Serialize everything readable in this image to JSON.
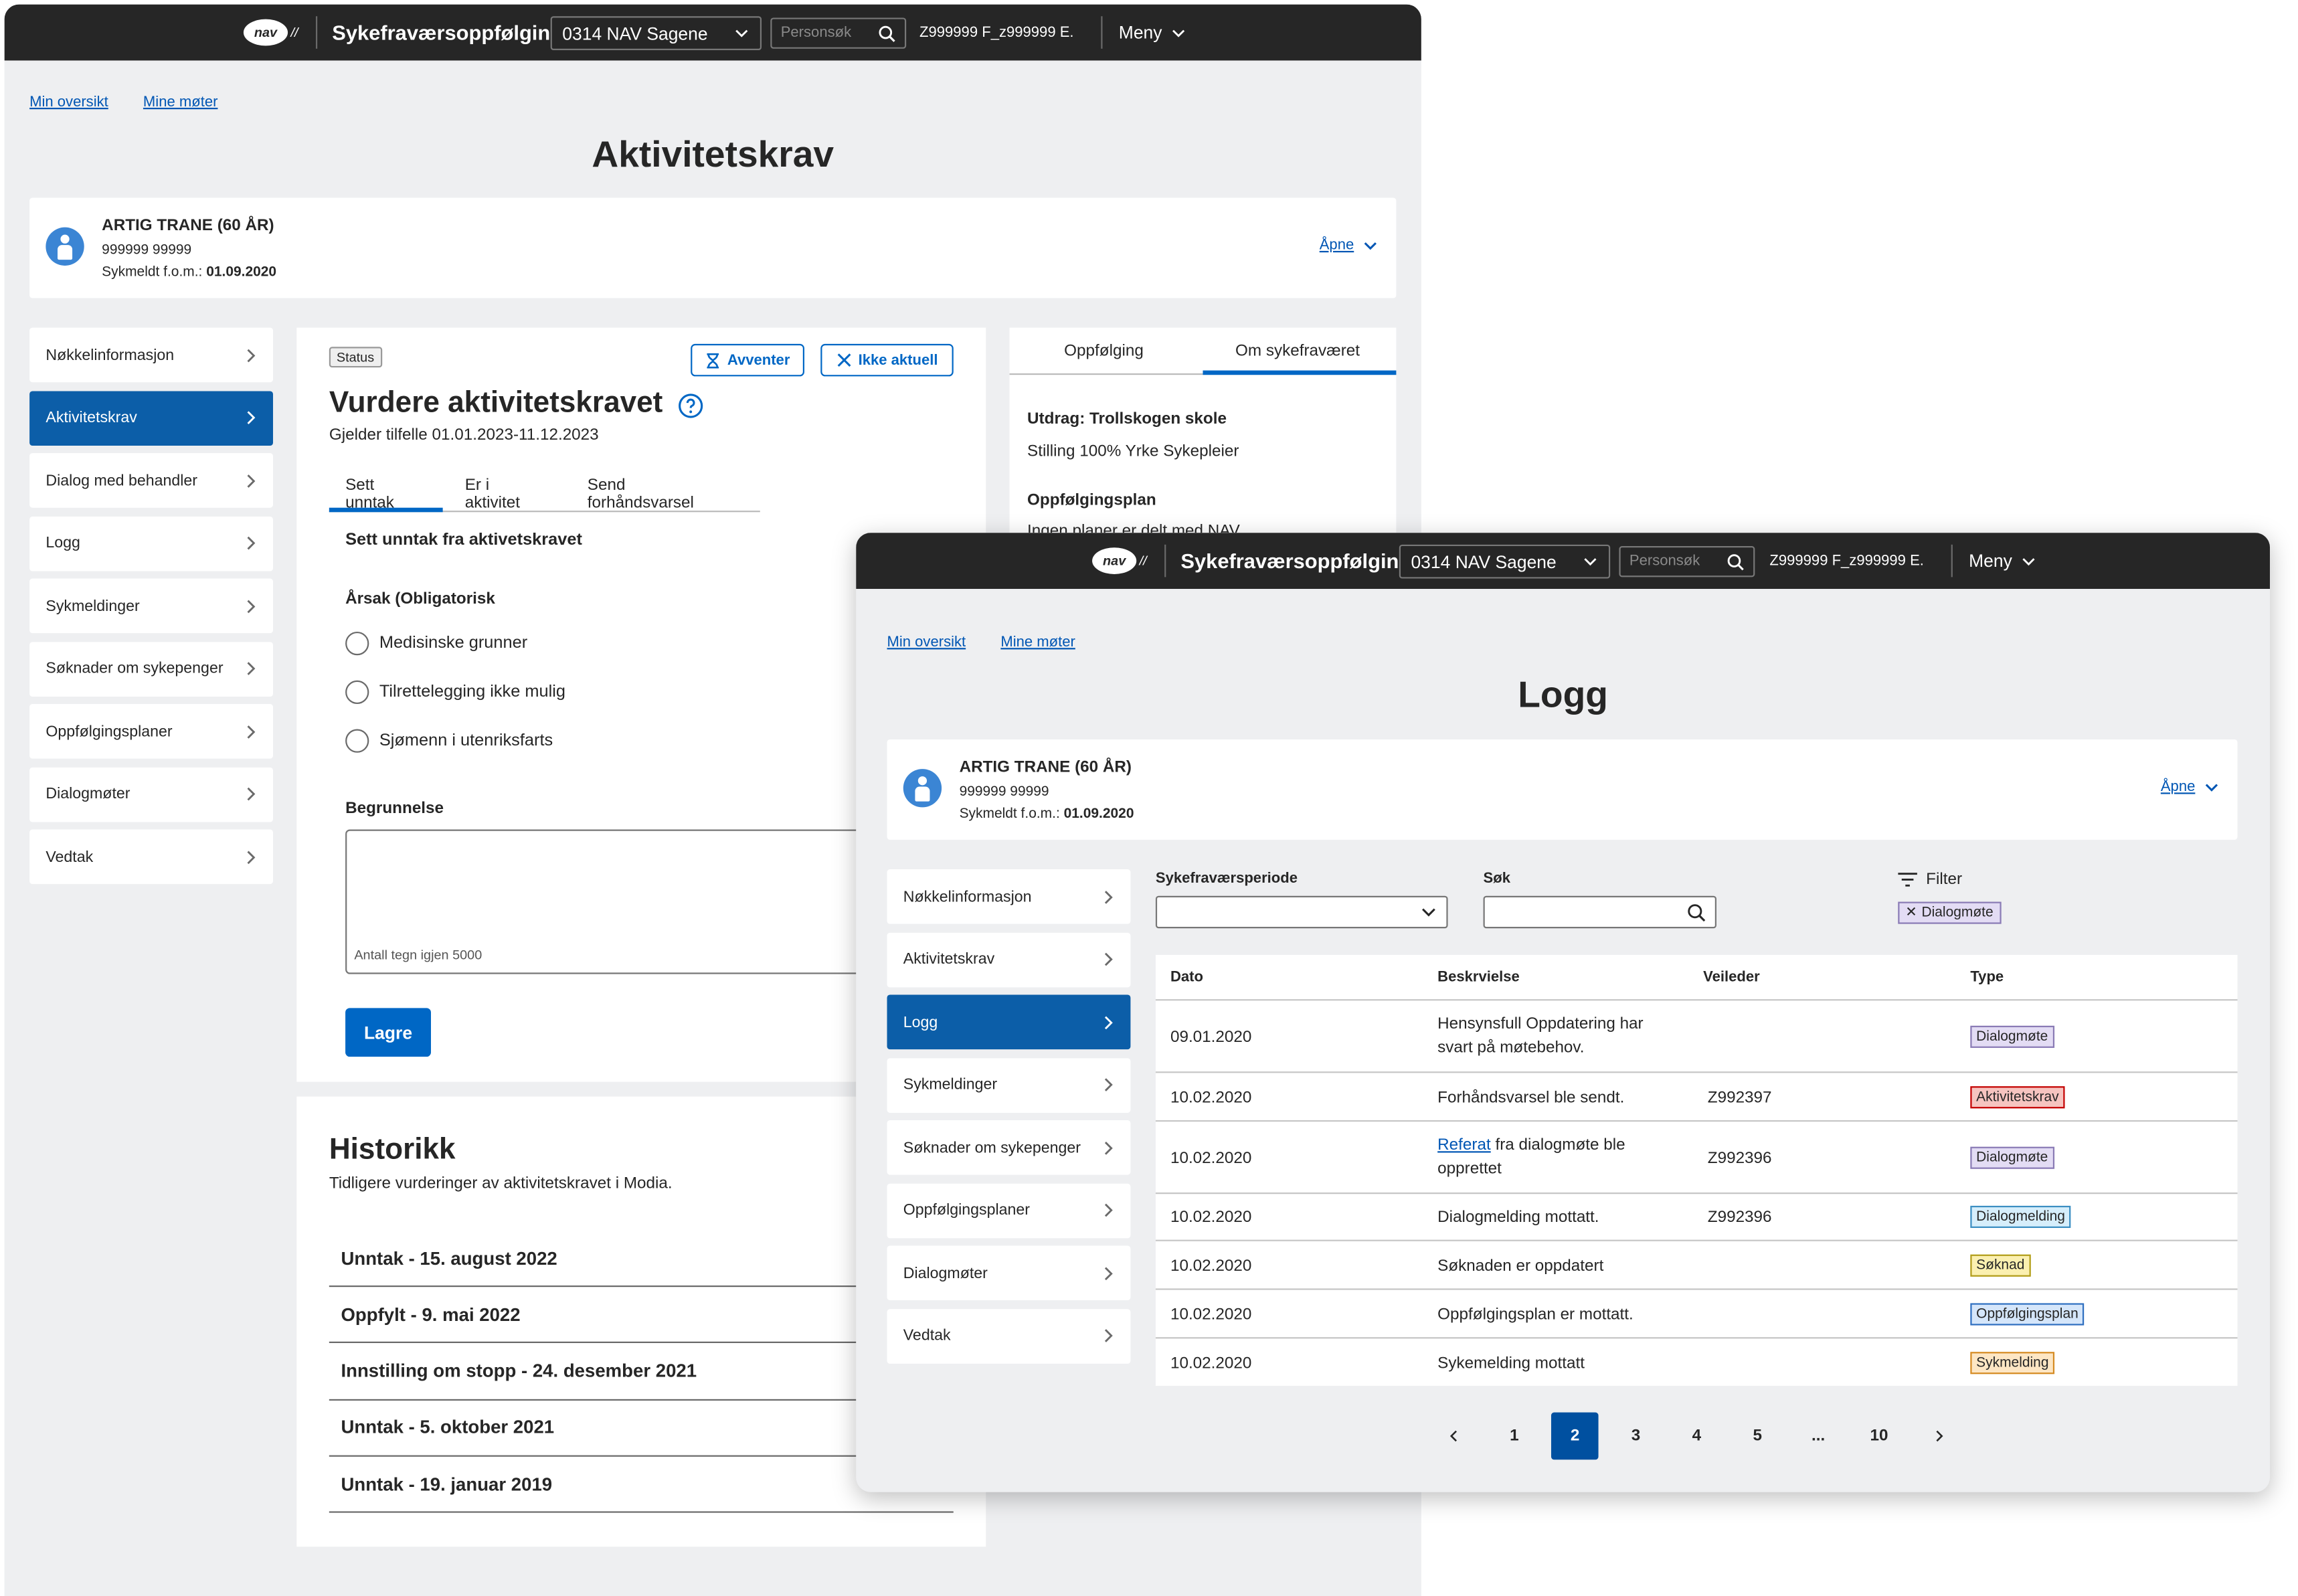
{
  "header": {
    "logo": "nav",
    "app_title": "Sykefraværsoppfølging",
    "unit_select": "0314 NAV Sagene",
    "search_placeholder": "Personsøk",
    "user": "Z999999 F_z999999 E.",
    "menu": "Meny"
  },
  "breadcrumbs": [
    "Min oversikt",
    "Mine møter"
  ],
  "person": {
    "name": "ARTIG TRANE (60 ÅR)",
    "fnr": "999999 99999",
    "sykmeldt_label": "Sykmeldt f.o.m.:",
    "sykmeldt_date": "01.09.2020",
    "open_link": "Åpne"
  },
  "screen_a": {
    "page_title": "Aktivitetskrav",
    "nav": [
      "Nøkkelinformasjon",
      "Aktivitetskrav",
      "Dialog med behandler",
      "Logg",
      "Sykmeldinger",
      "Søknader om sykepenger",
      "Oppfølgingsplaner",
      "Dialogmøter",
      "Vedtak"
    ],
    "status_tag": "Status",
    "avventer_btn": "Avventer",
    "ikke_aktuell_btn": "Ikke aktuell",
    "heading": "Vurdere aktivitetskravet",
    "subheading": "Gjelder tilfelle 01.01.2023-11.12.2023",
    "tabs": [
      "Sett unntak",
      "Er i aktivitet",
      "Send forhåndsvarsel"
    ],
    "form_title": "Sett unntak fra aktivetskravet",
    "reason_label": "Årsak (Obligatorisk",
    "reasons": [
      "Medisinske grunner",
      "Tilrettelegging ikke mulig",
      "Sjømenn i utenriksfarts"
    ],
    "justification_label": "Begrunnelse",
    "char_counter": "Antall tegn igjen 5000",
    "save_btn": "Lagre",
    "history_title": "Historikk",
    "history_subtitle": "Tidligere vurderinger av aktivitetskravet i Modia.",
    "history": [
      "Unntak - 15. august 2022",
      "Oppfylt - 9. mai 2022",
      "Innstilling om stopp - 24. desember 2021",
      "Unntak - 5. oktober 2021",
      "Unntak - 19. januar 2019"
    ],
    "right_tabs": [
      "Oppfølging",
      "Om sykefraværet"
    ],
    "excerpt_title": "Utdrag: Trollskogen skole",
    "excerpt_line": "Stilling 100%  Yrke Sykepleier",
    "plan_title": "Oppfølgingsplan",
    "plan_text": "Ingen planer er delt med NAV"
  },
  "screen_b": {
    "page_title": "Logg",
    "nav": [
      "Nøkkelinformasjon",
      "Aktivitetskrav",
      "Logg",
      "Sykmeldinger",
      "Søknader om sykepenger",
      "Oppfølgingsplaner",
      "Dialogmøter",
      "Vedtak"
    ],
    "period_label": "Sykefraværsperiode",
    "search_label": "Søk",
    "filter_label": "Filter",
    "active_filter": "Dialogmøte",
    "columns": [
      "Dato",
      "Beskrvielse",
      "Veileder",
      "Type"
    ],
    "rows": [
      {
        "date": "09.01.2020",
        "desc": "Hensynsfull Oppdatering har svart på møtebehov.",
        "link": "",
        "veileder": "",
        "type": "Dialogmøte",
        "type_color": "#e3dcf4",
        "type_border": "#8a7bb5"
      },
      {
        "date": "10.02.2020",
        "desc": "Forhåndsvarsel ble sendt.",
        "link": "",
        "veileder": "Z992397",
        "type": "Aktivitetskrav",
        "type_color": "#f6c4c0",
        "type_border": "#c30000"
      },
      {
        "date": "10.02.2020",
        "desc": "fra dialogmøte ble opprettet",
        "link": "Referat",
        "veileder": "Z992396",
        "type": "Dialogmøte",
        "type_color": "#e3dcf4",
        "type_border": "#8a7bb5"
      },
      {
        "date": "10.02.2020",
        "desc": "Dialogmelding mottatt.",
        "link": "",
        "veileder": "Z992396",
        "type": "Dialogmelding",
        "type_color": "#d6eefb",
        "type_border": "#3b8ec2"
      },
      {
        "date": "10.02.2020",
        "desc": "Søknaden er oppdatert",
        "link": "",
        "veileder": "",
        "type": "Søknad",
        "type_color": "#fbf0b0",
        "type_border": "#b29d1a"
      },
      {
        "date": "10.02.2020",
        "desc": "Oppfølgingsplan er mottatt.",
        "link": "",
        "veileder": "",
        "type": "Oppfølgingsplan",
        "type_color": "#d5e6fa",
        "type_border": "#2f6fc0"
      },
      {
        "date": "10.02.2020",
        "desc": "Sykemelding mottatt",
        "link": "",
        "veileder": "",
        "type": "Sykmelding",
        "type_color": "#fde6c4",
        "type_border": "#d58b23"
      }
    ],
    "pagination": [
      "1",
      "2",
      "3",
      "4",
      "5",
      "...",
      "10"
    ],
    "current_page": "2"
  },
  "colors": {
    "header_bg": "#262626",
    "page_bg": "#eeeff1",
    "primary": "#0067c5",
    "nav_active": "#0c5ea8"
  }
}
